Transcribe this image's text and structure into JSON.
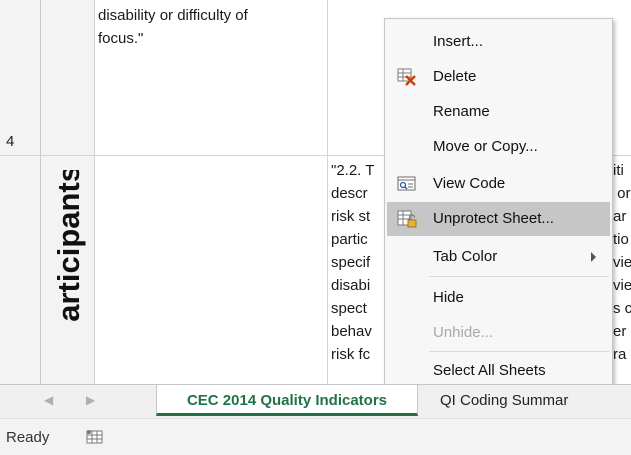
{
  "grid": {
    "row_number": "4",
    "cell_b_text": "disability or difficulty of\nfocus.\"",
    "cell_c_text": "\"2.2. T\ndescr\nrisk st\npartic\nspecif\ndisabi\nspect\nbehav\nrisk fc",
    "cell_d_text": "iti\n or\nar\ntio\nvie\nvie\ns c\ner\nra",
    "vertical_label": "articipants"
  },
  "context_menu": {
    "items": [
      {
        "label": "Insert...",
        "icon": "",
        "disabled": false
      },
      {
        "label": "Delete",
        "icon": "delete-sheet-icon",
        "disabled": false
      },
      {
        "label": "Rename",
        "icon": "",
        "disabled": false
      },
      {
        "label": "Move or Copy...",
        "icon": "",
        "disabled": false
      },
      {
        "label": "View Code",
        "icon": "view-code-icon",
        "disabled": false
      },
      {
        "label": "Unprotect Sheet...",
        "icon": "unprotect-sheet-icon",
        "disabled": false,
        "highlighted": true
      },
      {
        "label": "Tab Color",
        "icon": "",
        "disabled": false,
        "submenu": true
      },
      {
        "label": "Hide",
        "icon": "",
        "disabled": false
      },
      {
        "label": "Unhide...",
        "icon": "",
        "disabled": true
      },
      {
        "label": "Select All Sheets",
        "icon": "",
        "disabled": false
      }
    ]
  },
  "tabs": {
    "active": "CEC 2014 Quality Indicators",
    "inactive": "QI Coding Summar"
  },
  "status": {
    "text": "Ready"
  },
  "colors": {
    "accent": "#217346",
    "menu_highlight": "#c6c6c6",
    "delete_icon_red": "#d83b01"
  }
}
